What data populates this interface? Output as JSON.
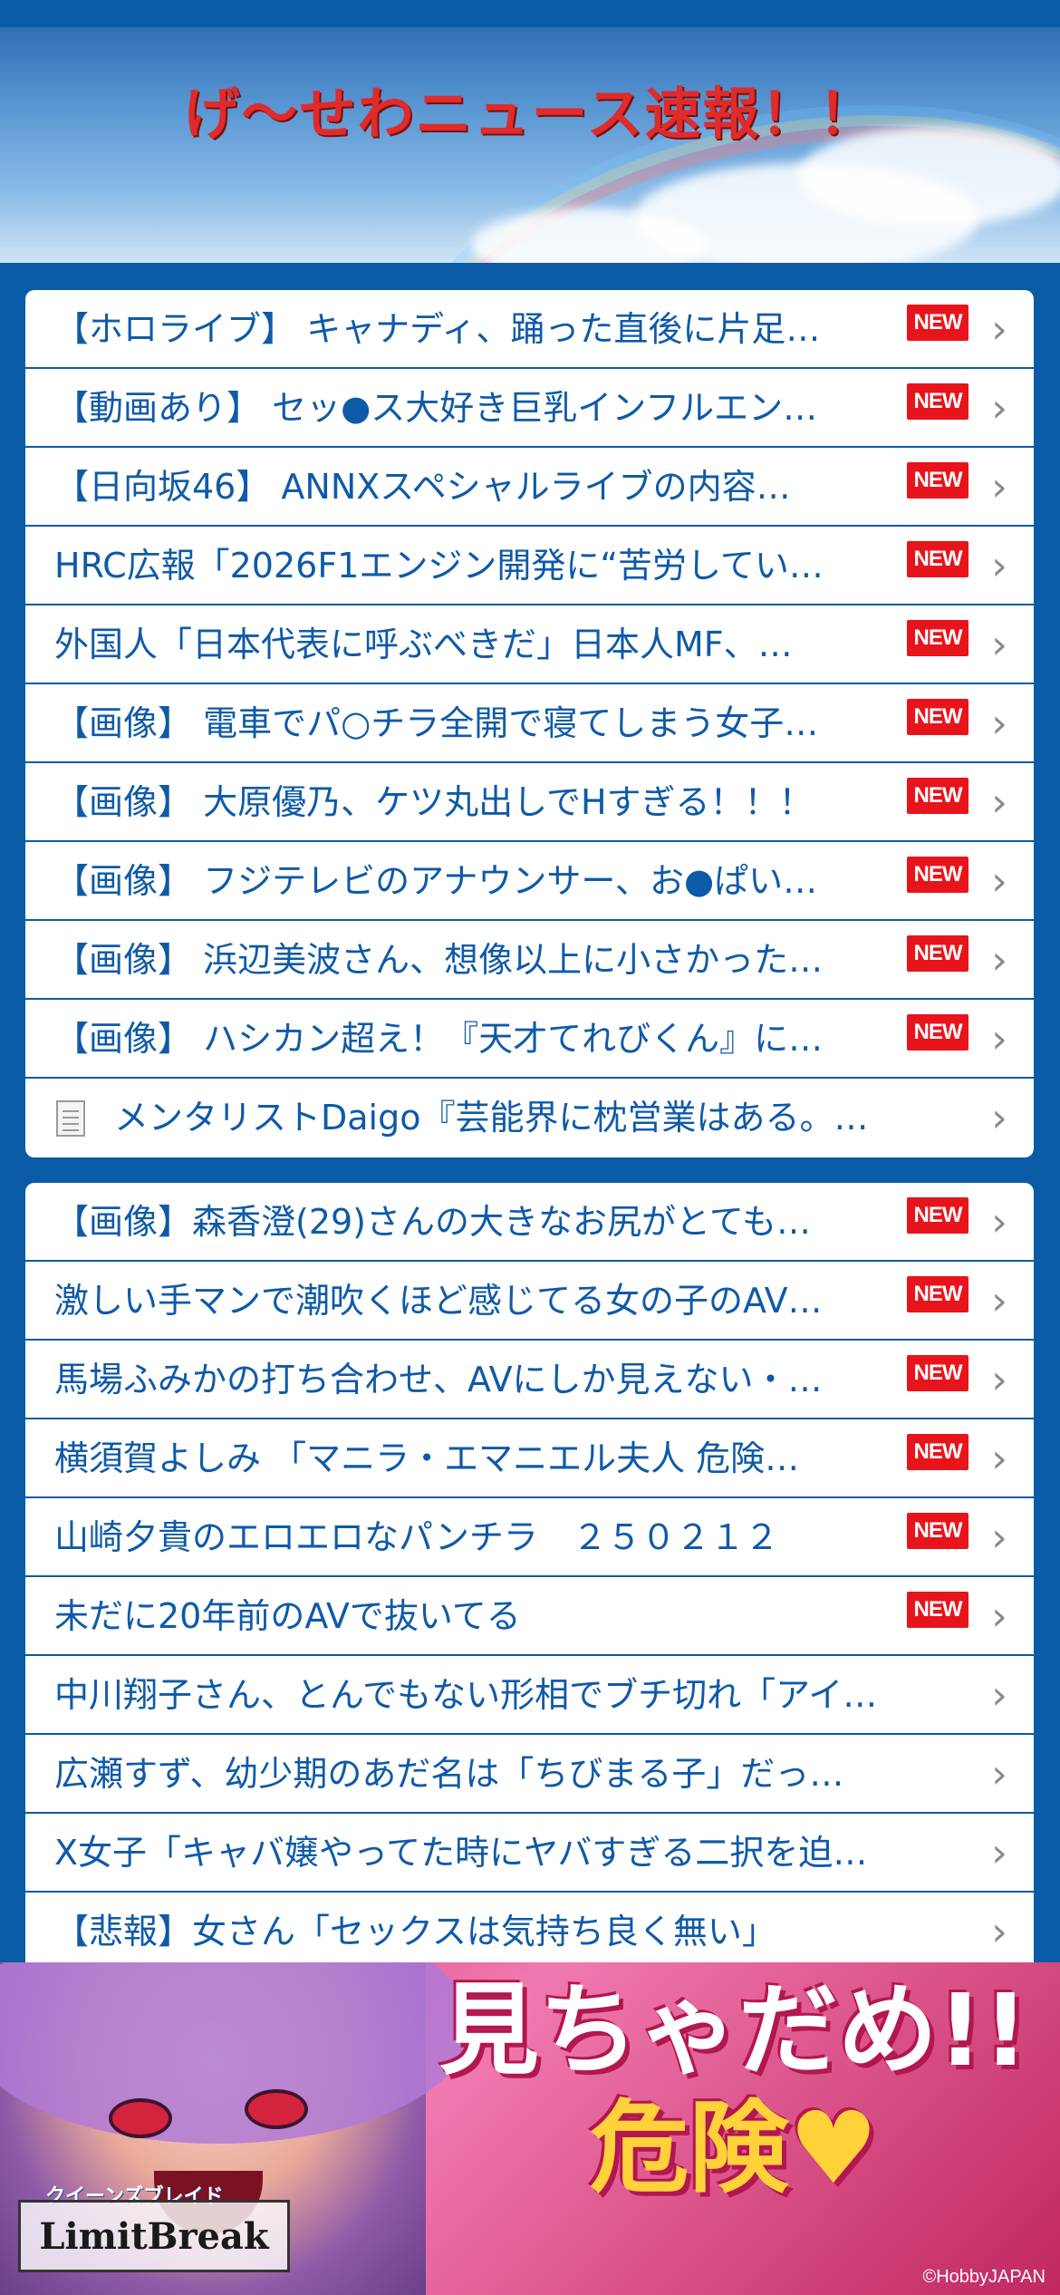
{
  "header": {
    "title": "げ〜せわニュース速報！！"
  },
  "badge_label": "NEW",
  "chevron_glyph": "›",
  "list1": [
    {
      "text": "【ホロライブ】 キャナディ、踊った直後に片足…",
      "new": true
    },
    {
      "text": "【動画あり】 セッ●ス大好き巨乳インフルエン…",
      "new": true
    },
    {
      "text": "【日向坂46】 ANNXスペシャルライブの内容…",
      "new": true
    },
    {
      "text": "HRC広報「2026F1エンジン開発に“苦労してい…",
      "new": true
    },
    {
      "text": "外国人「日本代表に呼ぶべきだ」日本人MF、…",
      "new": true
    },
    {
      "text": "【画像】 電車でパ○チラ全開で寝てしまう女子…",
      "new": true
    },
    {
      "text": "【画像】 大原優乃、ケツ丸出しでHすぎる！！！",
      "new": true
    },
    {
      "text": "【画像】 フジテレビのアナウンサー、お●ぱい…",
      "new": true
    },
    {
      "text": "【画像】 浜辺美波さん、想像以上に小さかった…",
      "new": true
    },
    {
      "text": "【画像】 ハシカン超え！『天才てれびくん』に…",
      "new": true
    },
    {
      "text": "メンタリストDaigo『芸能界に枕営業はある。…",
      "new": false,
      "icon": "document-icon"
    }
  ],
  "list2": [
    {
      "text": "【画像】森香澄(29)さんの大きなお尻がとても…",
      "new": true
    },
    {
      "text": "激しい手マンで潮吹くほど感じてる女の子のAV…",
      "new": true
    },
    {
      "text": "馬場ふみかの打ち合わせ、AVにしか見えない・…",
      "new": true
    },
    {
      "text": "横須賀よしみ 「マニラ・エマニエル夫人 危険…",
      "new": true
    },
    {
      "text": "山崎夕貴のエロエロなパンチラ　２５０２１２",
      "new": true
    },
    {
      "text": "未だに20年前のAVで抜いてる",
      "new": true
    },
    {
      "text": "中川翔子さん、とんでもない形相でブチ切れ「アイ…",
      "new": false
    },
    {
      "text": "広瀬すず、幼少期のあだ名は「ちびまる子」だっ…",
      "new": false
    },
    {
      "text": "X女子「キャバ嬢やってた時にヤバすぎる二択を迫…",
      "new": false
    },
    {
      "text": "【悲報】女さん「セックスは気持ち良く無い」",
      "new": false
    }
  ],
  "ad": {
    "headline_line1": "見ちゃだめ!!",
    "headline_line2": "危険♥",
    "logo_sub": "クイーンズブレイド",
    "logo": "LimitBreak",
    "copyright": "©HobbyJAPAN"
  },
  "colors": {
    "background": "#0a5ba6",
    "link_text": "#0f5aa8",
    "new_badge": "#e8141c",
    "title_red": "#e02b2b"
  }
}
